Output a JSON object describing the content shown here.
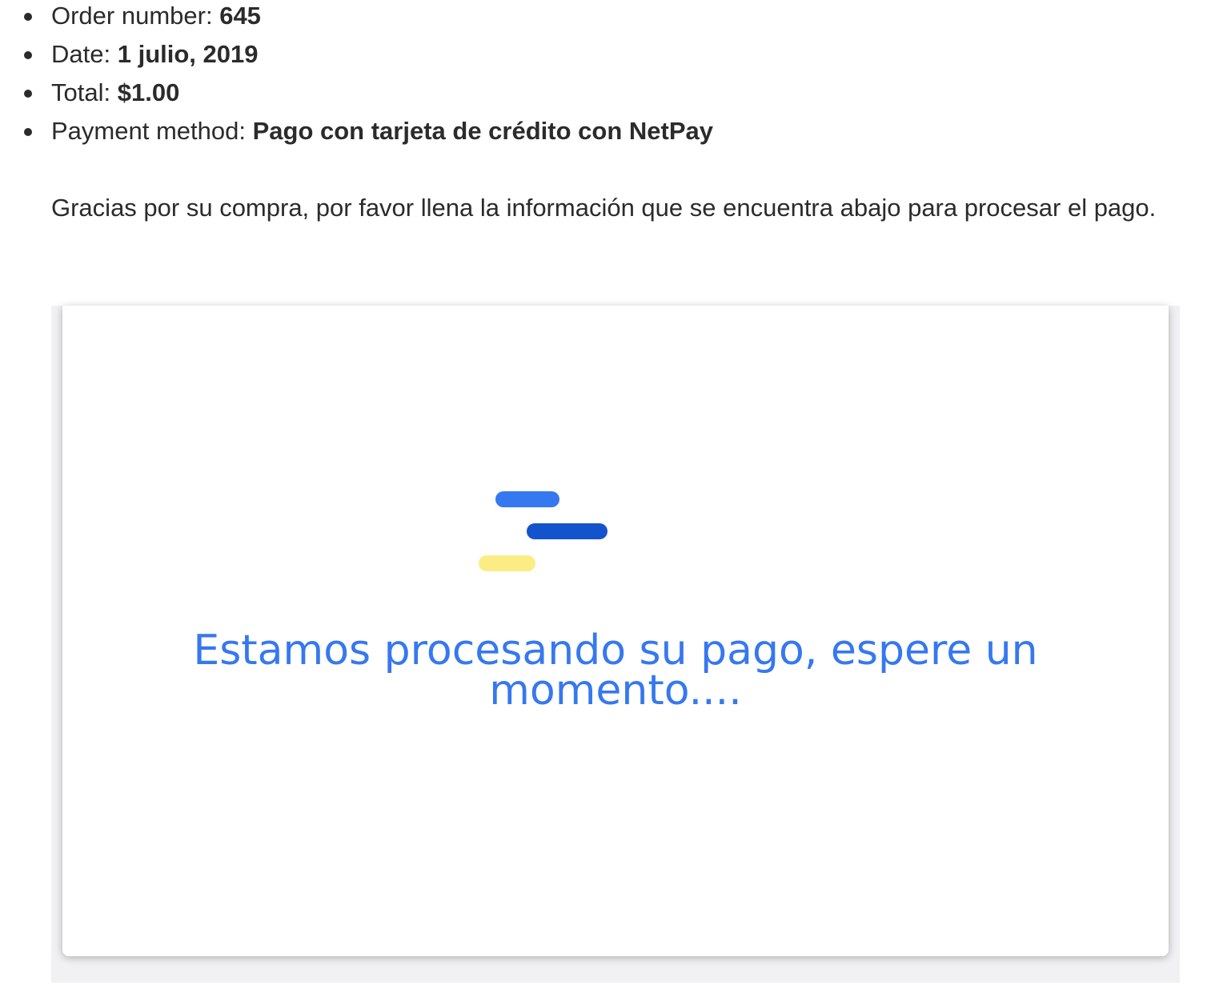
{
  "order": {
    "items": [
      {
        "label": "Order number:",
        "value": "645"
      },
      {
        "label": "Date:",
        "value": "1 julio, 2019"
      },
      {
        "label": "Total:",
        "value": "$1.00"
      },
      {
        "label": "Payment method:",
        "value": "Pago con tarjeta de crédito con NetPay"
      }
    ]
  },
  "thanks_text": "Gracias por su compra, por favor llena la información que se encuentra abajo para procesar el pago.",
  "payment_frame": {
    "message": "Estamos procesando su pago, espere un momento....",
    "loader_colors": [
      "#3678ef",
      "#1353cc",
      "#fbed84"
    ]
  }
}
